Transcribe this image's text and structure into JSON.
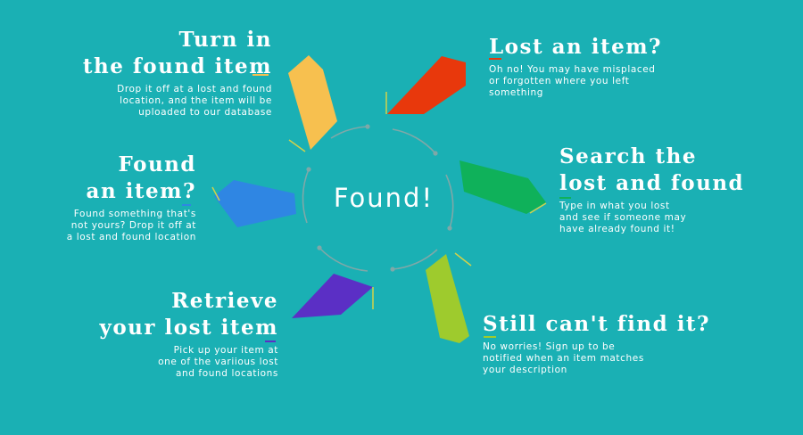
{
  "center": {
    "label": "Found!"
  },
  "colors": {
    "background": "#1ab0b4",
    "turn_in": "#f7c04f",
    "lost": "#e8380c",
    "search": "#0fb15a",
    "found": "#2f86e3",
    "still": "#9ecb2d",
    "retrieve": "#5b2fc5"
  },
  "steps": [
    {
      "id": "turn-in",
      "title_lines": [
        "Turn in",
        "the found item"
      ],
      "desc_lines": [
        "Drop it off at a lost and found",
        "location, and the item will be",
        "uploaded to our database"
      ]
    },
    {
      "id": "lost",
      "title_lines": [
        "Lost an item?"
      ],
      "desc_lines": [
        "Oh no! You may have misplaced",
        "or forgotten where you left",
        "something"
      ]
    },
    {
      "id": "search",
      "title_lines": [
        "Search the",
        "lost and found"
      ],
      "desc_lines": [
        "Type in what you lost",
        "and see if someone may",
        "have already found it!"
      ]
    },
    {
      "id": "found",
      "title_lines": [
        "Found",
        "an item?"
      ],
      "desc_lines": [
        "Found something that's",
        "not yours? Drop it off at",
        "a lost and found location"
      ]
    },
    {
      "id": "retrieve",
      "title_lines": [
        "Retrieve",
        "your lost item"
      ],
      "desc_lines": [
        "Pick up your item at",
        "one of the variious lost",
        "and found locations"
      ]
    },
    {
      "id": "still",
      "title_lines": [
        "Still can't find it?"
      ],
      "desc_lines": [
        "No worries! Sign up to be",
        "notified when an item matches",
        "your description"
      ]
    }
  ]
}
